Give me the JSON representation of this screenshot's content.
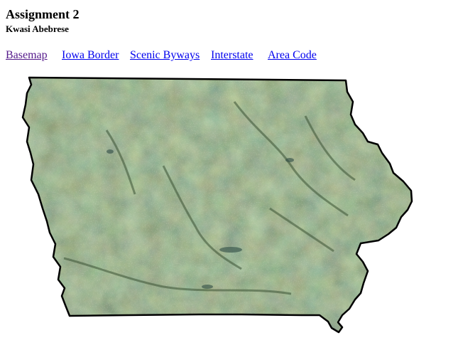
{
  "header": {
    "title": "Assignment 2",
    "author": "Kwasi Abebrese"
  },
  "nav": {
    "links": [
      {
        "label": "Basemap",
        "visited": true
      },
      {
        "label": "Iowa Border",
        "visited": false
      },
      {
        "label": "Scenic Byways",
        "visited": false
      },
      {
        "label": "Interstate",
        "visited": false
      },
      {
        "label": "Area Code",
        "visited": false
      }
    ]
  },
  "map": {
    "layer": "satellite imagery",
    "region": "Iowa",
    "colors": {
      "border": "#000000",
      "land_base": "#5f6a49",
      "land_dark": "#3f5a35",
      "land_light": "#8b8f6d",
      "water": "#2f4b45"
    }
  }
}
